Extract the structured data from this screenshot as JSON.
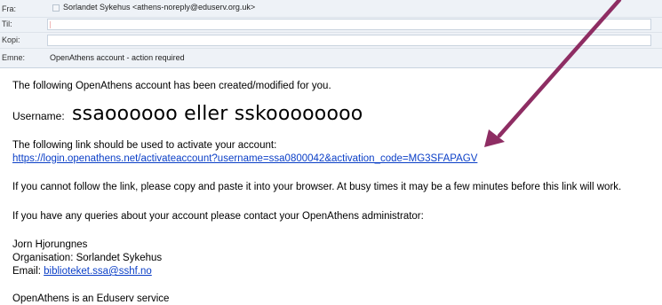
{
  "header": {
    "from_label": "Fra:",
    "from_value": "Sorlandet Sykehus <athens-noreply@eduserv.org.uk>",
    "to_label": "Til:",
    "cc_label": "Kopi:",
    "subject_label": "Emne:",
    "subject_value": "OpenAthens account - action required"
  },
  "body": {
    "intro": "The following OpenAthens account has been created/modified for you.",
    "username_label": "Username:",
    "username_value": "ssaoooooo eller sskoooooooo",
    "link_intro": "The following link should be used to activate your account:",
    "activation_link": "https://login.openathens.net/activateaccount?username=ssa0800042&activation_code=MG3SFAPAGV",
    "paste_note": "If you cannot follow the link, please copy and paste it into your browser. At busy times it may be a few minutes before this link will work.",
    "queries_note": "If you have any queries about your account please contact your OpenAthens administrator:",
    "signature_name": "Jorn Hjorungnes",
    "signature_org": "Organisation: Sorlandet Sykehus",
    "signature_email_label": "Email:",
    "signature_email": "biblioteket.ssa@sshf.no",
    "footer": "OpenAthens is an Eduserv service"
  },
  "annotation": {
    "arrow_color": "#8e2d63",
    "icon": "arrow-pointing-to-link"
  }
}
